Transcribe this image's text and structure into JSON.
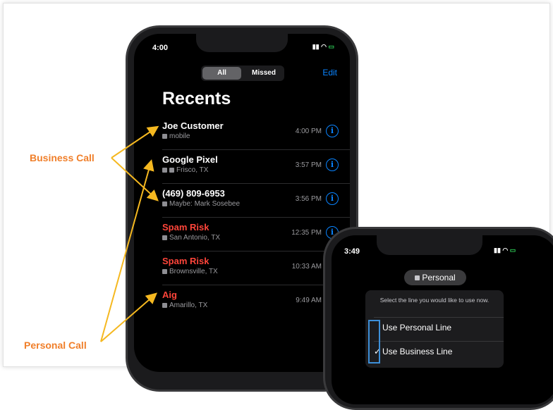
{
  "annotations": {
    "business_call": "Business Call",
    "personal_call": "Personal Call"
  },
  "phone1": {
    "status_time": "4:00",
    "segments": {
      "all": "All",
      "missed": "Missed"
    },
    "edit": "Edit",
    "title": "Recents",
    "calls": [
      {
        "name": "Joe Customer",
        "sub": "mobile",
        "time": "4:00 PM",
        "spam": false
      },
      {
        "name": "Google Pixel",
        "sub": "Frisco, TX",
        "time": "3:57 PM",
        "spam": false
      },
      {
        "name": "(469) 809-6953",
        "sub": "Maybe: Mark Sosebee",
        "time": "3:56 PM",
        "spam": false
      },
      {
        "name": "Spam Risk",
        "sub": "San Antonio, TX",
        "time": "12:35 PM",
        "spam": true
      },
      {
        "name": "Spam Risk",
        "sub": "Brownsville, TX",
        "time": "10:33 AM",
        "spam": true
      },
      {
        "name": "Aig",
        "sub": "Amarillo, TX",
        "time": "9:49 AM",
        "spam": true
      }
    ]
  },
  "phone2": {
    "status_time": "3:49",
    "line_pill": "Personal",
    "prompt": "Select the line you would like to use now.",
    "options": [
      {
        "label": "Use Personal Line",
        "checked": false
      },
      {
        "label": "Use Business Line",
        "checked": true
      }
    ]
  },
  "colors": {
    "accent": "#0a84ff",
    "spam": "#ff453a",
    "annotation": "#f07f2a",
    "arrow": "#f5b820"
  }
}
